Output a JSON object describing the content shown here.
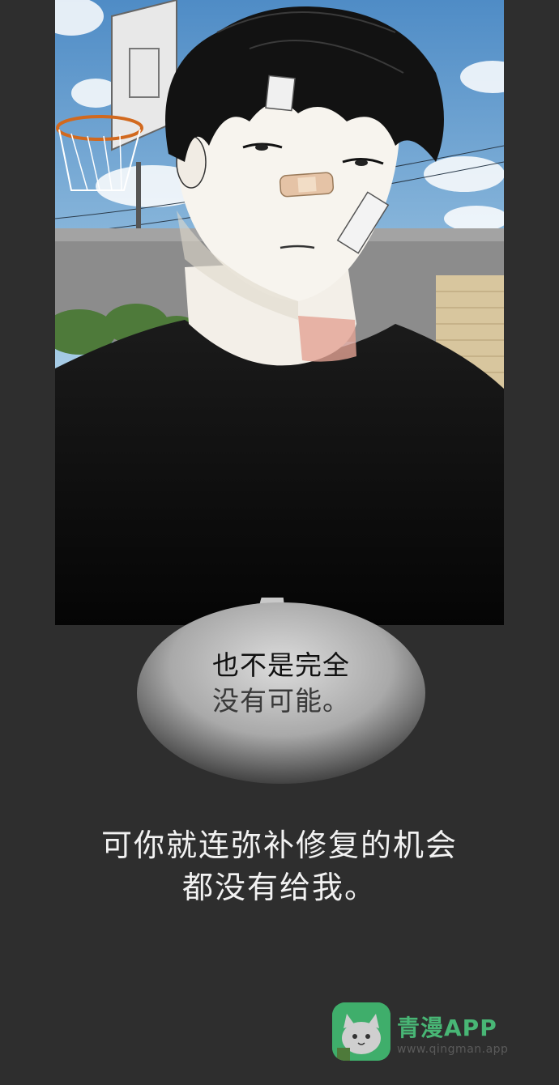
{
  "bubble": {
    "line1": "也不是完全",
    "line2": "没有可能。"
  },
  "narration": {
    "line1": "可你就连弥补修复的机会",
    "line2": "都没有给我。"
  },
  "watermark": {
    "name": "青漫APP",
    "url": "www.qingman.app",
    "brand_color": "#48b675"
  },
  "colors": {
    "page_background": "#2e2e2e",
    "sky": "#6aa6d6"
  }
}
